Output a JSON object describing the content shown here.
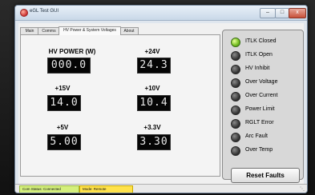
{
  "window": {
    "title": "eGL Test GUI",
    "minimize_label": "–",
    "maximize_label": "□",
    "close_label": "x"
  },
  "tabs": [
    {
      "label": "Main",
      "active": false
    },
    {
      "label": "Comms",
      "active": false
    },
    {
      "label": "HV Power & System Voltages",
      "active": true
    },
    {
      "label": "About",
      "active": false
    }
  ],
  "meters": {
    "hv_power": {
      "label": "HV POWER (W)",
      "value": "000.0"
    },
    "p24v": {
      "label": "+24V",
      "value": "24.3"
    },
    "p15v": {
      "label": "+15V",
      "value": "14.0"
    },
    "p10v": {
      "label": "+10V",
      "value": "10.4"
    },
    "p5v": {
      "label": "+5V",
      "value": "5.00"
    },
    "p3v3": {
      "label": "+3.3V",
      "value": "3.30"
    }
  },
  "status_indicators": [
    {
      "label": "ITLK Closed",
      "state": "on"
    },
    {
      "label": "ITLK Open",
      "state": "off"
    },
    {
      "label": "HV Inhibit",
      "state": "off"
    },
    {
      "label": "Over Voltage",
      "state": "off"
    },
    {
      "label": "Over Current",
      "state": "off"
    },
    {
      "label": "Power Limit",
      "state": "off"
    },
    {
      "label": "RGLT Error",
      "state": "off"
    },
    {
      "label": "Arc Fault",
      "state": "off"
    },
    {
      "label": "Over Temp",
      "state": "off"
    }
  ],
  "reset_button": {
    "label": "Reset Faults"
  },
  "statusbar": {
    "comm_status": "Com Status: Connected",
    "mode": "Mode: Remote",
    "comm_color": "#d4ef7c",
    "mode_color": "#ffe24a"
  },
  "colors": {
    "led_on": "#7ac226",
    "led_off": "#2d2d2d",
    "meter_bg": "#050505",
    "meter_text": "#e8e8e8"
  }
}
